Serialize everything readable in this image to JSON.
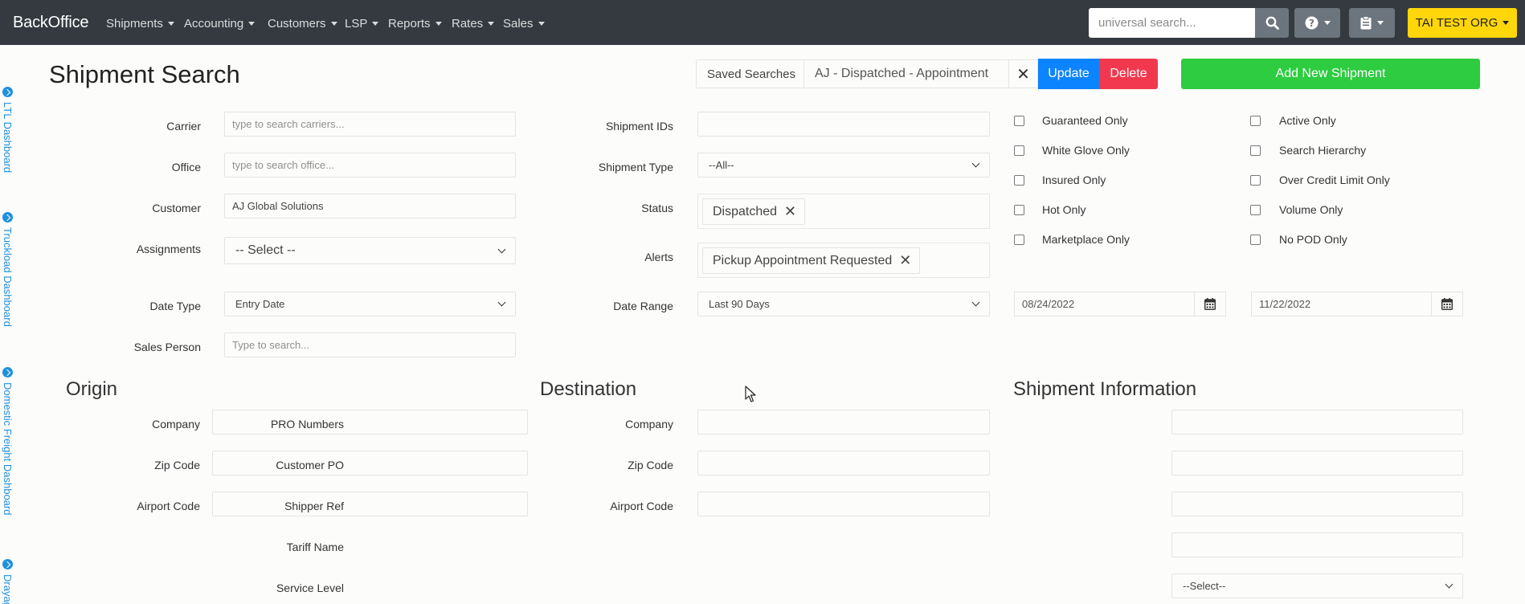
{
  "nav": {
    "brand": "BackOffice",
    "menus": [
      "Shipments",
      "Accounting",
      "Customers",
      "LSP",
      "Reports",
      "Rates",
      "Sales"
    ],
    "search_placeholder": "universal search...",
    "org_label": "TAI TEST ORG"
  },
  "side_links": [
    "LTL Dashboard",
    "Truckload Dashboard",
    "Domestic Freight Dashboard",
    "Drayage"
  ],
  "page_title": "Shipment Search",
  "saved": {
    "label": "Saved Searches",
    "value": "AJ - Dispatched - Appointment",
    "clear": "✕",
    "update": "Update",
    "delete": "Delete",
    "add_new": "Add New Shipment"
  },
  "form": {
    "carrier": {
      "label": "Carrier",
      "placeholder": "type to search carriers..."
    },
    "office": {
      "label": "Office",
      "placeholder": "type to search office..."
    },
    "customer": {
      "label": "Customer",
      "value": "AJ Global Solutions"
    },
    "assignments": {
      "label": "Assignments",
      "value": "-- Select --"
    },
    "date_type": {
      "label": "Date Type",
      "value": "Entry Date"
    },
    "sales_person": {
      "label": "Sales Person",
      "placeholder": "Type to search..."
    },
    "shipment_ids": {
      "label": "Shipment IDs",
      "value": ""
    },
    "shipment_type": {
      "label": "Shipment Type",
      "value": "--All--"
    },
    "status": {
      "label": "Status",
      "tag": "Dispatched"
    },
    "alerts": {
      "label": "Alerts",
      "tag": "Pickup Appointment Requested"
    },
    "date_range": {
      "label": "Date Range",
      "value": "Last 90 Days",
      "from": "08/24/2022",
      "to": "11/22/2022"
    },
    "tag_remove": "✕"
  },
  "checkboxes_left": [
    "Guaranteed Only",
    "White Glove Only",
    "Insured Only",
    "Hot Only",
    "Marketplace Only"
  ],
  "checkboxes_right": [
    "Active Only",
    "Search Hierarchy",
    "Over Credit Limit Only",
    "Volume Only",
    "No POD Only"
  ],
  "origin": {
    "title": "Origin",
    "company": "Company",
    "zip": "Zip Code",
    "airport": "Airport Code"
  },
  "destination": {
    "title": "Destination",
    "company": "Company",
    "zip": "Zip Code",
    "airport": "Airport Code"
  },
  "shipment_info": {
    "title": "Shipment Information",
    "pro": "PRO Numbers",
    "customer_po": "Customer PO",
    "shipper_ref": "Shipper Ref",
    "tariff": "Tariff Name",
    "service_level": "Service Level",
    "service_level_value": "--Select--"
  },
  "colors": {
    "navbar": "#343a40",
    "update": "#0d84ff",
    "delete": "#f2384e",
    "add": "#2ecc40",
    "org": "#ffd60a",
    "link": "#1e90e0"
  }
}
